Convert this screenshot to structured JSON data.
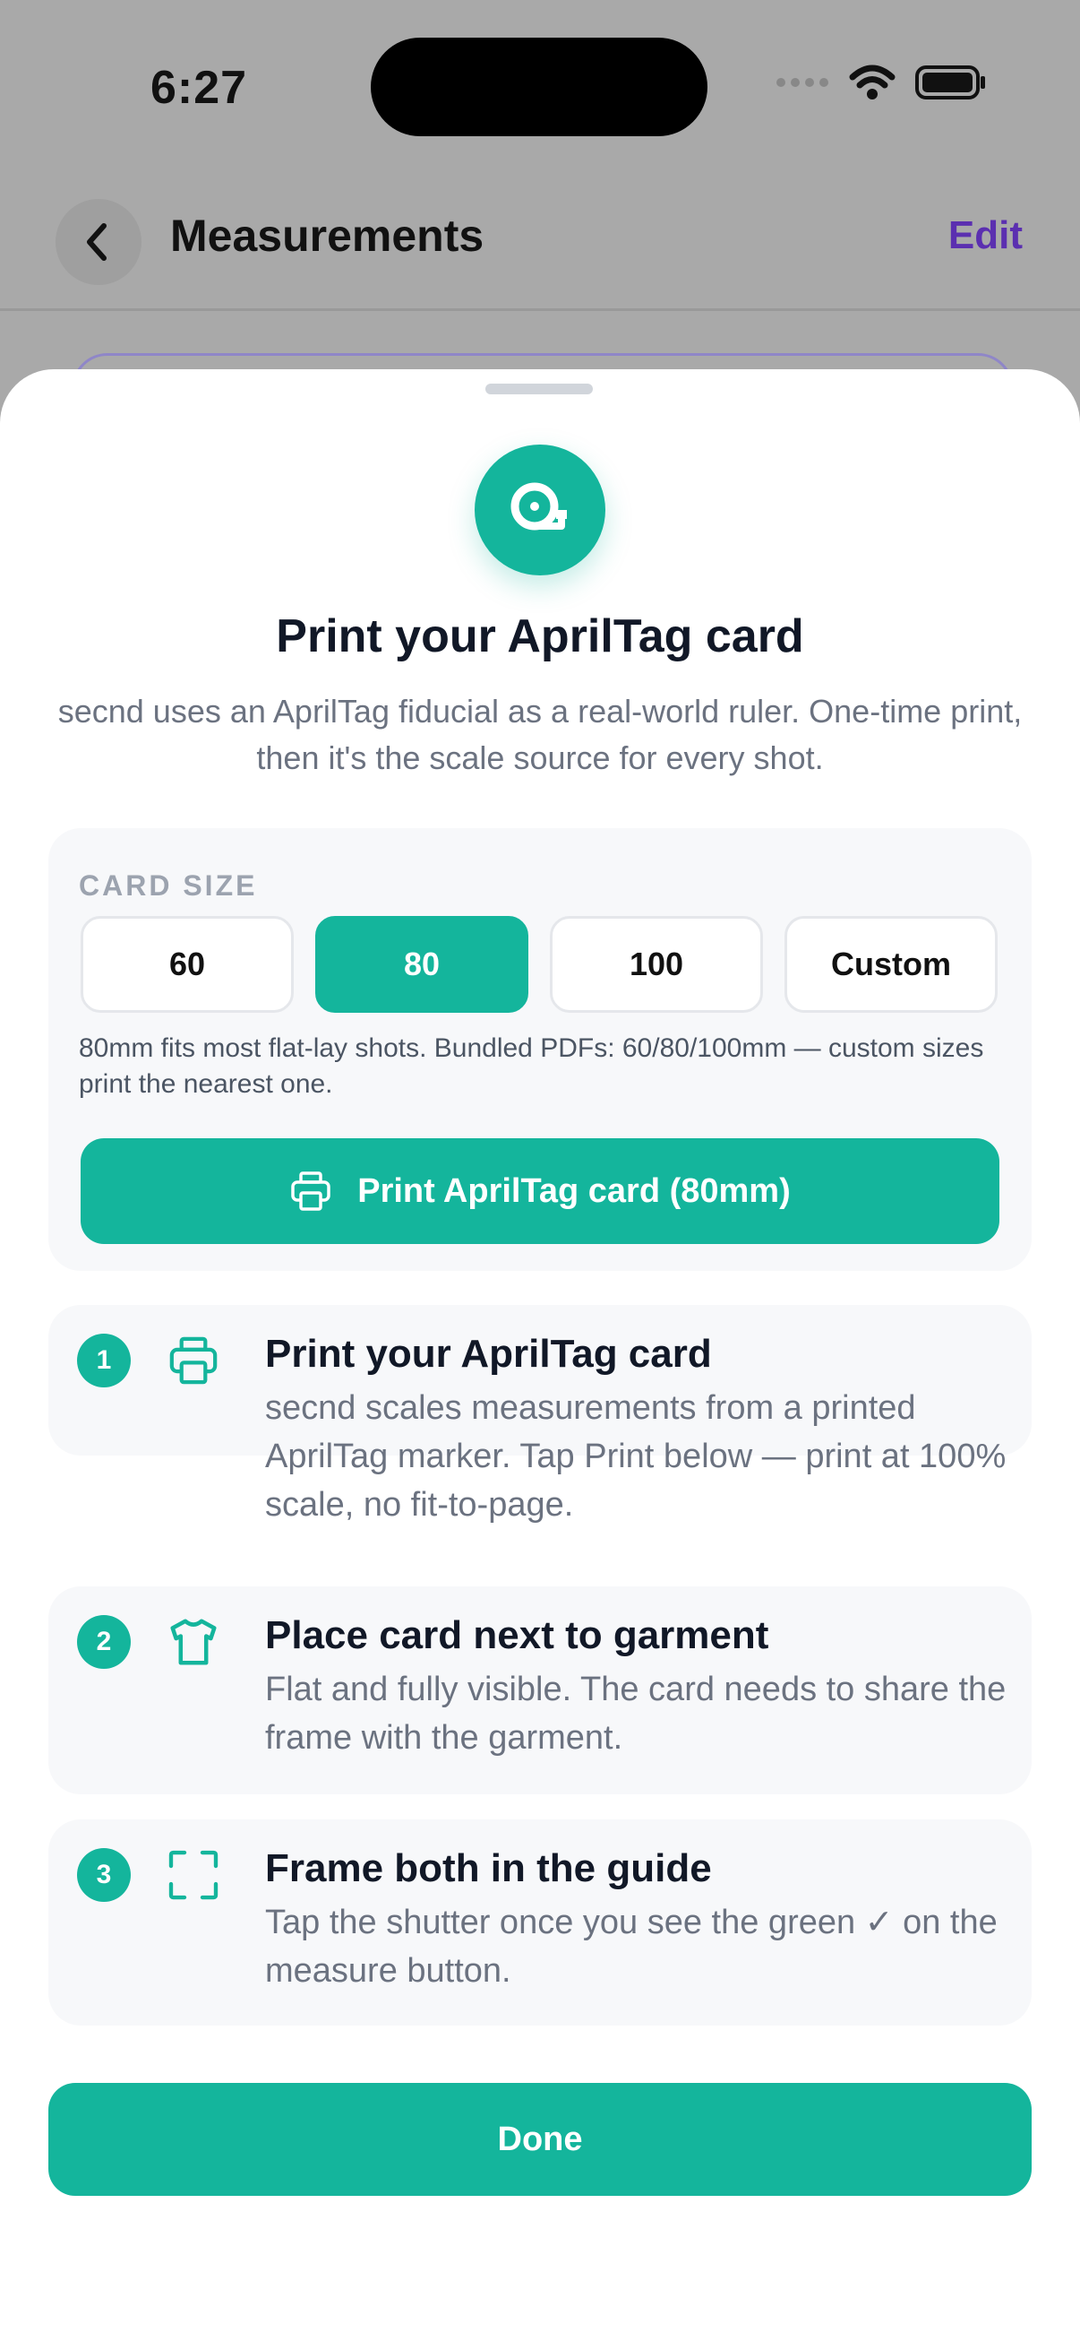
{
  "status_bar": {
    "time": "6:27",
    "icons": [
      "signal-dots-icon",
      "wifi-icon",
      "battery-icon"
    ]
  },
  "nav": {
    "title": "Measurements",
    "edit_label": "Edit",
    "back_icon": "chevron-left-icon"
  },
  "sheet": {
    "hero_icon": "tape-measure-icon",
    "title": "Print your AprilTag card",
    "subtitle": "secnd uses an AprilTag fiducial as a real-world ruler. One-time print, then it's the scale source for every shot.",
    "card_size": {
      "label": "CARD SIZE",
      "options": [
        "60",
        "80",
        "100",
        "Custom"
      ],
      "selected": "80",
      "hint": "80mm fits most flat-lay shots. Bundled PDFs: 60/80/100mm — custom sizes print the nearest one."
    },
    "print_button": {
      "label": "Print AprilTag card (80mm)",
      "icon": "printer-icon"
    },
    "steps": [
      {
        "number": "1",
        "icon": "printer-icon",
        "title": "Print your AprilTag card",
        "body": "secnd scales measurements from a printed AprilTag marker. Tap Print below — print at 100% scale, no fit-to-page."
      },
      {
        "number": "2",
        "icon": "tshirt-icon",
        "title": "Place card next to garment",
        "body": "Flat and fully visible. The card needs to share the frame with the garment."
      },
      {
        "number": "3",
        "icon": "frame-corners-icon",
        "title": "Frame both in the guide",
        "body": "Tap the shutter once you see the green ✓ on the measure button."
      }
    ],
    "done_label": "Done"
  },
  "colors": {
    "accent": "#14b59c",
    "edit": "#5b2fb0",
    "title": "#111827",
    "muted": "#6b7280"
  }
}
